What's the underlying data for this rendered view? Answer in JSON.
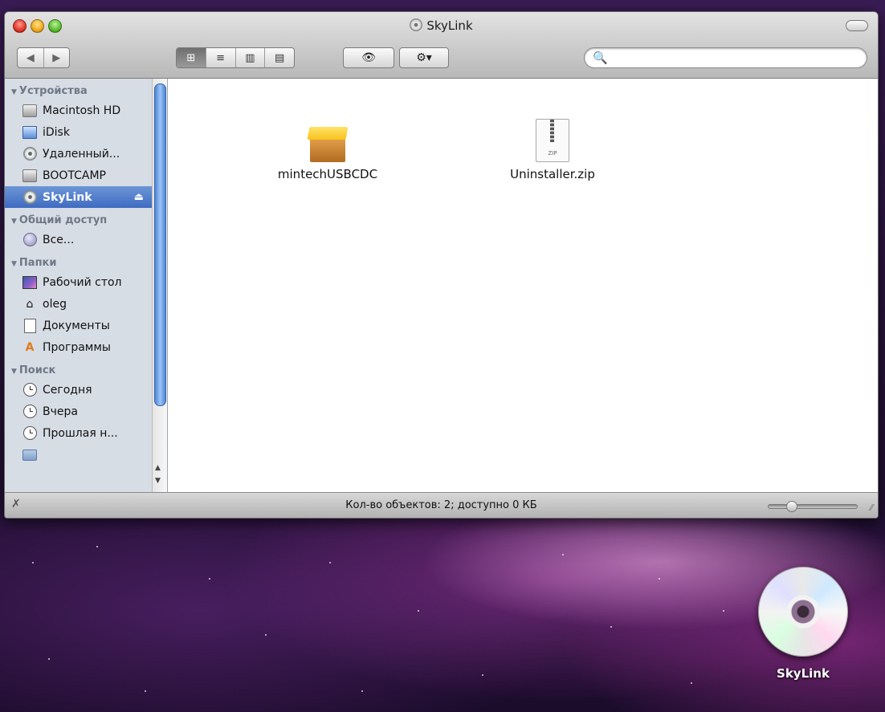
{
  "window": {
    "title": "SkyLink"
  },
  "toolbar": {
    "back_icon": "◀",
    "forward_icon": "▶",
    "view_icons": [
      "⊞",
      "≡",
      "▥",
      "▤"
    ],
    "quicklook_icon": "👁",
    "action_icon": "⚙▾",
    "search_icon": "🔍",
    "search_value": ""
  },
  "sidebar": {
    "sections": [
      {
        "title": "Устройства",
        "items": [
          {
            "label": "Macintosh HD",
            "icon": "hard-drive-icon"
          },
          {
            "label": "iDisk",
            "icon": "idisk-icon"
          },
          {
            "label": "Удаленный...",
            "icon": "remote-disc-icon"
          },
          {
            "label": "BOOTCAMP",
            "icon": "hard-drive-icon"
          },
          {
            "label": "SkyLink",
            "icon": "cd-icon",
            "selected": true,
            "eject": "⏏"
          }
        ]
      },
      {
        "title": "Общий доступ",
        "items": [
          {
            "label": "Все...",
            "icon": "network-icon"
          }
        ]
      },
      {
        "title": "Папки",
        "items": [
          {
            "label": "Рабочий стол",
            "icon": "desktop-icon"
          },
          {
            "label": "oleg",
            "icon": "home-icon"
          },
          {
            "label": "Документы",
            "icon": "documents-icon"
          },
          {
            "label": "Программы",
            "icon": "applications-icon"
          }
        ]
      },
      {
        "title": "Поиск",
        "items": [
          {
            "label": "Сегодня",
            "icon": "clock-icon"
          },
          {
            "label": "Вчера",
            "icon": "clock-icon"
          },
          {
            "label": "Прошлая н...",
            "icon": "clock-icon"
          }
        ]
      }
    ]
  },
  "files": [
    {
      "name": "mintechUSBCDC",
      "icon": "package-icon"
    },
    {
      "name": "Uninstaller.zip",
      "icon": "zip-icon",
      "badge": "ZIP"
    }
  ],
  "statusbar": {
    "text": "Кол-во объектов: 2; доступно 0 КБ",
    "zoom_fraction": 0.22
  },
  "desktop": {
    "disc_label": "SkyLink"
  }
}
